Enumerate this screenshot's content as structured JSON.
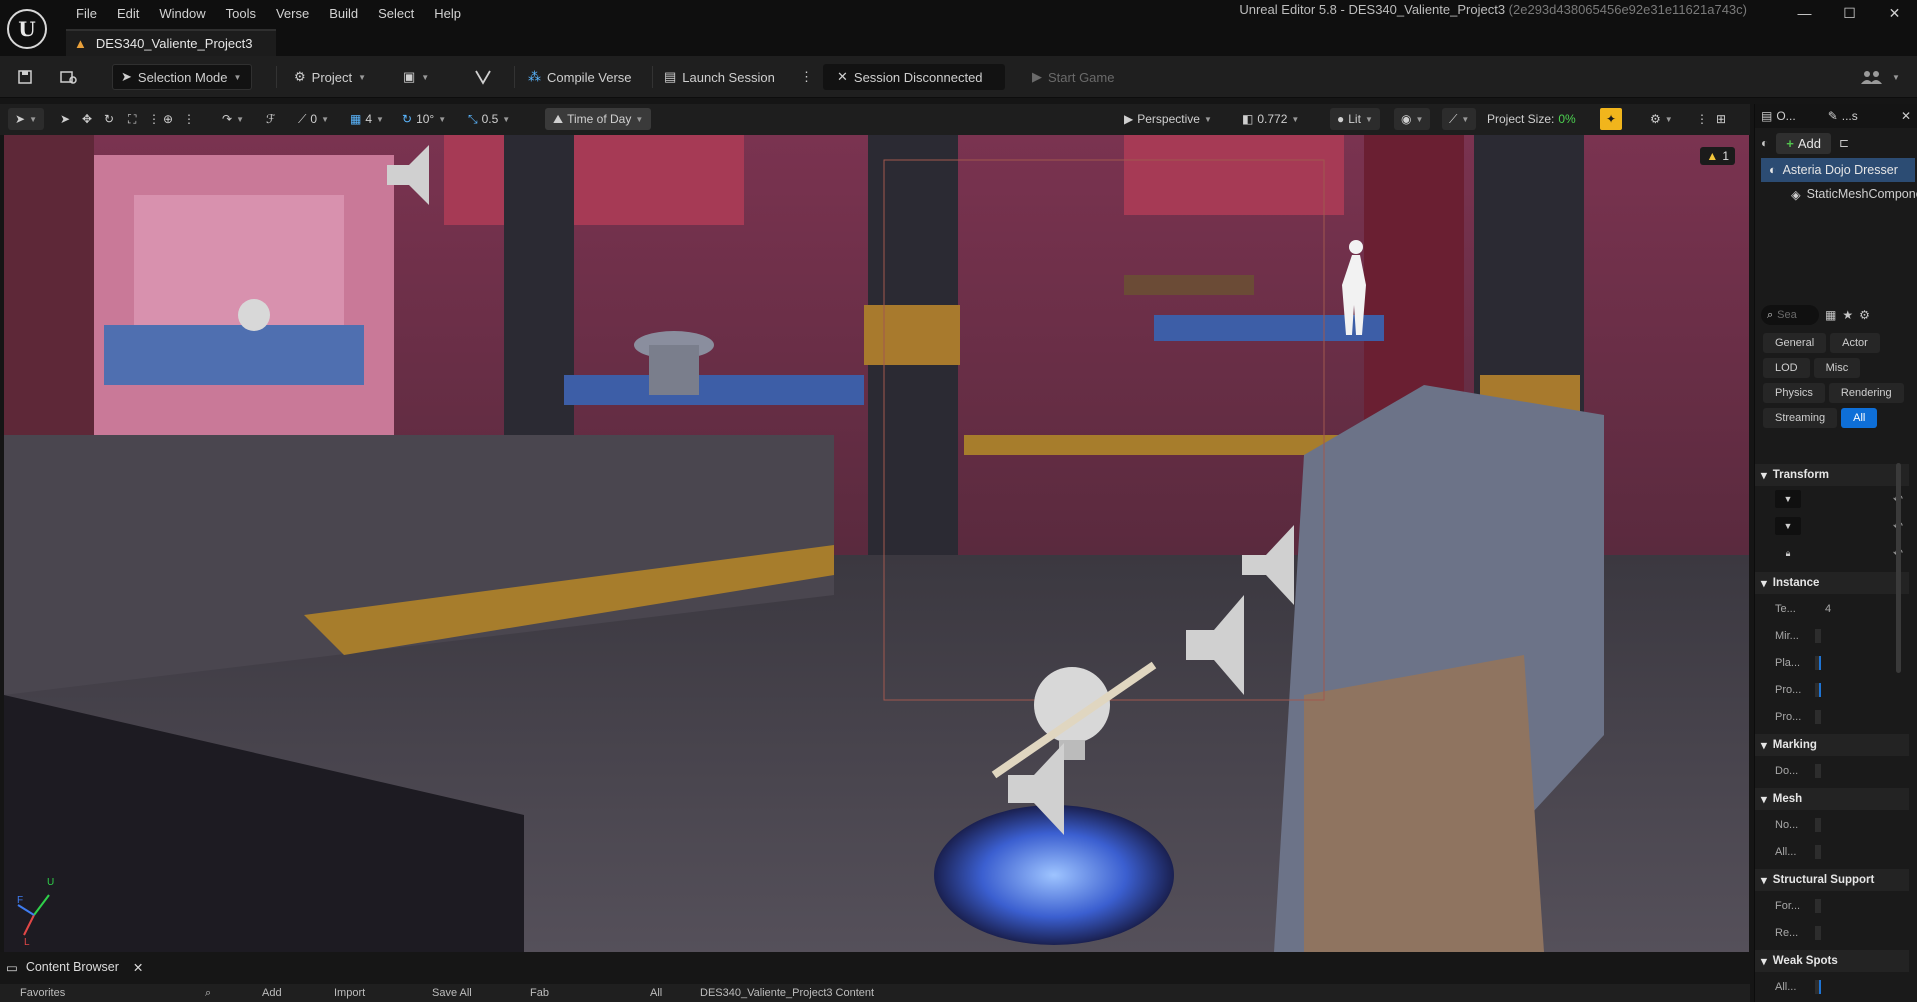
{
  "window": {
    "title": "Unreal Editor 5.8 - DES340_Valiente_Project3",
    "hash": "(2e293d438065456e92e31e11621a743c)",
    "logo_text": "U",
    "minimize": "—",
    "maximize": "☐",
    "close": "✕"
  },
  "menu": [
    "File",
    "Edit",
    "Window",
    "Tools",
    "Verse",
    "Build",
    "Select",
    "Help"
  ],
  "doc_tab": {
    "label": "DES340_Valiente_Project3",
    "icon": "level-icon"
  },
  "toolbar": {
    "selection_mode": "Selection Mode",
    "project": "Project",
    "compile_verse": "Compile Verse",
    "launch_session": "Launch Session",
    "session_status": "Session Disconnected",
    "start_game": "Start Game"
  },
  "viewport_toolbar": {
    "rotate_snap": "0",
    "grid_snap": "4",
    "angle_snap": "10°",
    "scale_snap": "0.5",
    "time_of_day": "Time of Day",
    "view_mode": "Perspective",
    "camera_speed": "0.772",
    "lighting": "Lit",
    "project_size_label": "Project Size:",
    "project_size_value": "0%"
  },
  "viewport": {
    "warning_count": "1",
    "axis": {
      "up": "U",
      "forward": "F",
      "left": "L"
    }
  },
  "details_panel": {
    "tab_outliner": "O...",
    "tab_details": "...s",
    "add_label": "Add",
    "selected_actor": "Asteria Dojo Dresser",
    "component": "StaticMeshComponent",
    "search_placeholder": "Sea",
    "filters": [
      "General",
      "Actor",
      "LOD",
      "Misc",
      "Physics",
      "Rendering",
      "Streaming",
      "All"
    ],
    "active_filter": "All",
    "sections": {
      "transform": "Transform",
      "instance": "Instance",
      "marking": "Marking",
      "mesh": "Mesh",
      "structural": "Structural Support",
      "weak_spots": "Weak Spots"
    },
    "props": {
      "te": "Te...",
      "te_val": "4",
      "mir": "Mir...",
      "pla": "Pla...",
      "pro1": "Pro...",
      "pro2": "Pro...",
      "do": "Do...",
      "no": "No...",
      "all1": "All...",
      "for": "For...",
      "re": "Re...",
      "all2": "All..."
    }
  },
  "content_browser": {
    "tab_label": "Content Browser",
    "favorites": "Favorites",
    "add": "Add",
    "import": "Import",
    "save_all": "Save All",
    "fab": "Fab",
    "path_root": "All",
    "path": "DES340_Valiente_Project3 Content"
  },
  "colors": {
    "accent_blue": "#0e6fd8",
    "project_size_green": "#4cd150",
    "warning_yellow": "#f3c63b",
    "tod_orange": "#e9a03a"
  }
}
